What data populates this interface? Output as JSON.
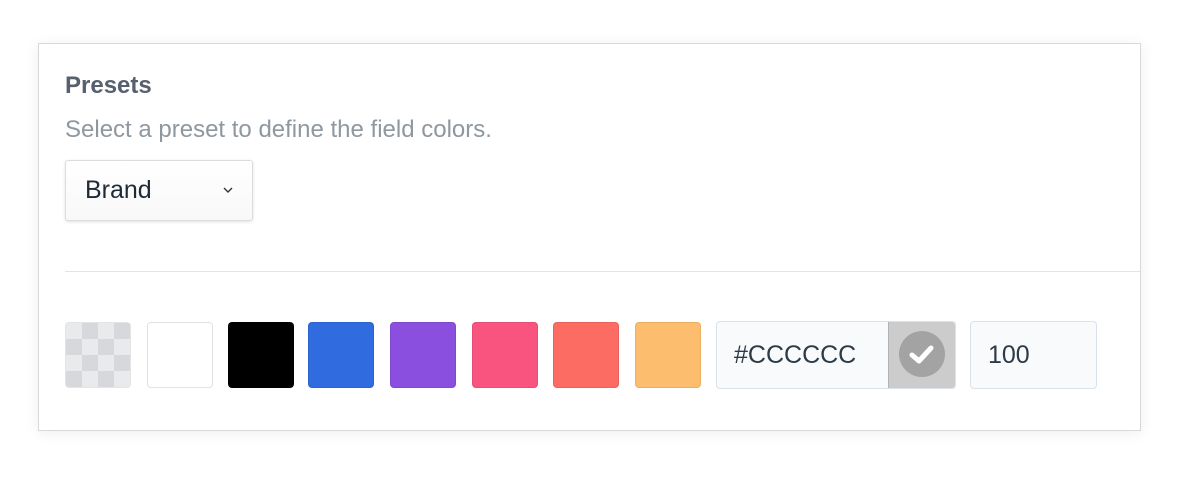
{
  "presets": {
    "title": "Presets",
    "description": "Select a preset to define the field colors.",
    "select": {
      "value": "Brand",
      "icon": "chevron-down-icon"
    }
  },
  "palette": {
    "swatches": [
      {
        "name": "transparent",
        "color": "transparent"
      },
      {
        "name": "white",
        "color": "#FFFFFF"
      },
      {
        "name": "black",
        "color": "#000000"
      },
      {
        "name": "blue",
        "color": "#306CDF"
      },
      {
        "name": "purple",
        "color": "#8A4FDF"
      },
      {
        "name": "pink",
        "color": "#F95380"
      },
      {
        "name": "coral",
        "color": "#FC6C63"
      },
      {
        "name": "orange",
        "color": "#FCBE6E"
      }
    ],
    "hex_value": "#CCCCCC",
    "preview_color": "#CCCCCC",
    "preview_icon": "check-circle-icon",
    "opacity_value": "100"
  }
}
